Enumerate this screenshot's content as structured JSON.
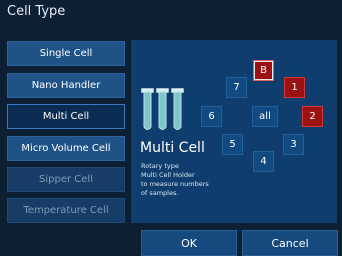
{
  "dialog": {
    "title": "Cell Type"
  },
  "cell_types": [
    {
      "label": "Single Cell"
    },
    {
      "label": "Nano Handler"
    },
    {
      "label": "Multi Cell"
    },
    {
      "label": "Micro Volume Cell"
    },
    {
      "label": "Sipper Cell"
    },
    {
      "label": "Temperature Cell"
    }
  ],
  "detail": {
    "name": "Multi Cell",
    "description": "Rotary type\nMulti Cell Holder\nto measure numbers\nof samples."
  },
  "positions": {
    "B": "B",
    "p1": "1",
    "p2": "2",
    "p3": "3",
    "p4": "4",
    "p5": "5",
    "p6": "6",
    "p7": "7",
    "all": "all"
  },
  "buttons": {
    "ok": "OK",
    "cancel": "Cancel"
  },
  "colors": {
    "background": "#0d1f33",
    "button": "#1f5388",
    "selected": "#0a2c52",
    "panel": "#0f3e6e",
    "active_position": "#9c1111"
  }
}
